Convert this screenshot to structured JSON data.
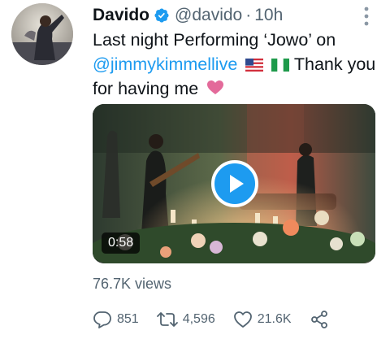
{
  "author": {
    "name": "Davido",
    "handle": "@davido",
    "separator": "·",
    "time": "10h"
  },
  "tweet": {
    "text_before": "Last night Performing ‘Jowo’ on",
    "mention": "@jimmykimmellive",
    "text_after": "Thank you for having me",
    "emojis": [
      "us-flag",
      "nigeria-flag",
      "pink-heart"
    ]
  },
  "video": {
    "duration": "0:58"
  },
  "stats": {
    "views": "76.7K views"
  },
  "actions": {
    "replies": "851",
    "retweets": "4,596",
    "likes": "21.6K"
  },
  "colors": {
    "accent": "#1d9bf0",
    "text": "#0f1419",
    "muted": "#536471",
    "heart_emoji": "#e36a9a"
  }
}
